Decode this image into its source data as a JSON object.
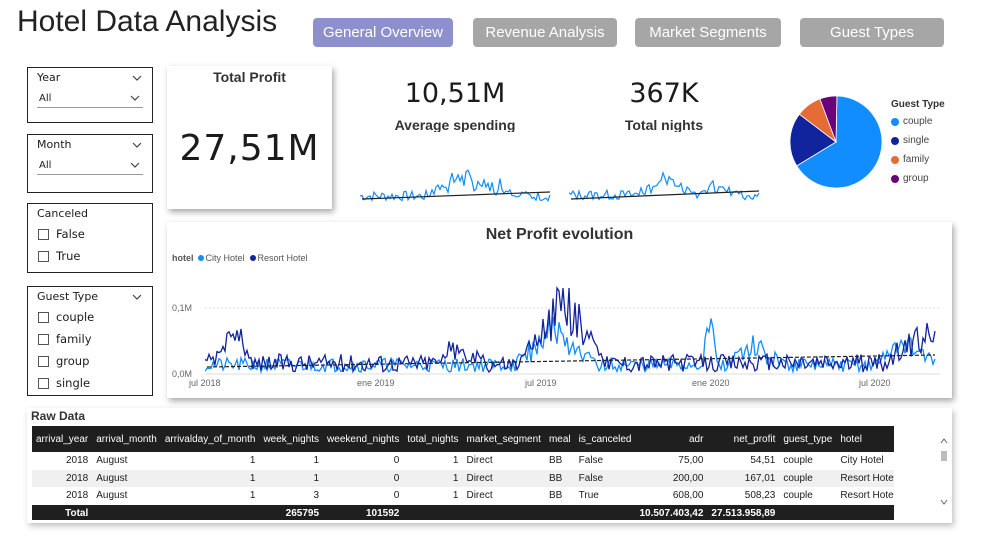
{
  "header": {
    "title": "Hotel Data Analysis",
    "tabs": [
      {
        "label": "General Overview",
        "active": true,
        "color": "#8e8fcd"
      },
      {
        "label": "Revenue Analysis",
        "active": false,
        "color": "#a6a6a6"
      },
      {
        "label": "Market Segments",
        "active": false,
        "color": "#a6a6a6"
      },
      {
        "label": "Guest Types",
        "active": false,
        "color": "#a6a6a6"
      }
    ]
  },
  "filters": {
    "year": {
      "label": "Year",
      "value": "All"
    },
    "month": {
      "label": "Month",
      "value": "All"
    },
    "canceled": {
      "label": "Canceled",
      "options": [
        "False",
        "True"
      ]
    },
    "guest_type": {
      "label": "Guest Type",
      "options": [
        "couple",
        "family",
        "group",
        "single"
      ]
    }
  },
  "kpis": {
    "total_profit": {
      "label": "Total Profit",
      "value": "27,51M"
    },
    "avg_spending": {
      "label": "Average spending",
      "value": "10,51M"
    },
    "total_nights": {
      "label": "Total nights",
      "value": "367K"
    }
  },
  "pie": {
    "legend_title": "Guest Type",
    "slices": [
      {
        "name": "couple",
        "fraction": 0.66,
        "color": "#118dff"
      },
      {
        "name": "single",
        "fraction": 0.19,
        "color": "#12239e"
      },
      {
        "name": "family",
        "fraction": 0.09,
        "color": "#e66c37"
      },
      {
        "name": "group",
        "fraction": 0.06,
        "color": "#6b007b"
      }
    ]
  },
  "net_profit_chart": {
    "title": "Net Profit evolution",
    "legend_label": "hotel",
    "series": [
      {
        "name": "City Hotel",
        "color": "#118dff"
      },
      {
        "name": "Resort Hotel",
        "color": "#12239e"
      }
    ],
    "y_ticks": [
      "0,1M",
      "0,0M"
    ],
    "x_ticks": [
      "jul 2018",
      "ene 2019",
      "jul 2019",
      "ene 2020",
      "jul 2020"
    ]
  },
  "raw_data": {
    "title": "Raw Data",
    "columns": [
      "arrival_year",
      "arrival_month",
      "arrivalday_of_month",
      "week_nights",
      "weekend_nights",
      "total_nights",
      "market_segment",
      "meal",
      "is_canceled",
      "adr",
      "net_profit",
      "guest_type",
      "hotel"
    ],
    "rows": [
      [
        "2018",
        "August",
        "1",
        "1",
        "0",
        "1",
        "Direct",
        "BB",
        "False",
        "75,00",
        "54,51",
        "couple",
        "City Hotel"
      ],
      [
        "2018",
        "August",
        "1",
        "1",
        "0",
        "1",
        "Direct",
        "BB",
        "False",
        "200,00",
        "167,01",
        "couple",
        "Resort Hotel"
      ],
      [
        "2018",
        "August",
        "1",
        "3",
        "0",
        "1",
        "Direct",
        "BB",
        "True",
        "608,00",
        "508,23",
        "couple",
        "Resort Hotel"
      ]
    ],
    "total": [
      "Total",
      "",
      "",
      "265795",
      "101592",
      "",
      "",
      "",
      "",
      "10.507.403,42",
      "27.513.958,89",
      "",
      ""
    ]
  }
}
